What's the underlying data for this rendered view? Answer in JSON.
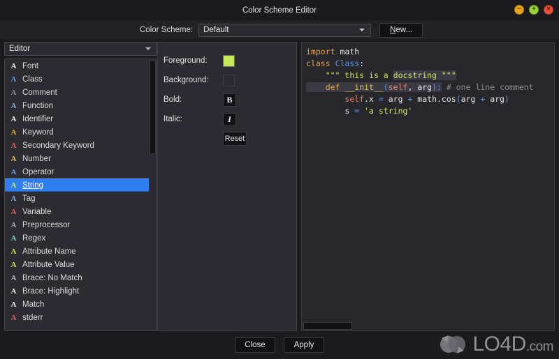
{
  "window": {
    "title": "Color Scheme Editor",
    "controls": [
      {
        "name": "minimize-button",
        "glyph": "−",
        "color": "#e8a51c"
      },
      {
        "name": "maximize-button",
        "glyph": "+",
        "color": "#9bd535"
      },
      {
        "name": "close-button",
        "glyph": "×",
        "color": "#e8533c"
      }
    ]
  },
  "scheme_bar": {
    "label": "Color Scheme:",
    "combo_value": "Default",
    "combo_options": [
      "Default"
    ],
    "new_button": "New..."
  },
  "left_panel": {
    "category_combo_value": "Editor",
    "category_options": [
      "Editor"
    ],
    "items": [
      {
        "label": "Font",
        "glyph": "A",
        "color": "#f2f2f2"
      },
      {
        "label": "Class",
        "glyph": "A",
        "color": "#5a9bf0"
      },
      {
        "label": "Comment",
        "glyph": "A",
        "color": "#8b8b93"
      },
      {
        "label": "Function",
        "glyph": "A",
        "color": "#7fb3e8"
      },
      {
        "label": "Identifier",
        "glyph": "A",
        "color": "#f2f2f2"
      },
      {
        "label": "Keyword",
        "glyph": "A",
        "color": "#e8b33c"
      },
      {
        "label": "Secondary Keyword",
        "glyph": "A",
        "color": "#e8604c"
      },
      {
        "label": "Number",
        "glyph": "A",
        "color": "#e8c84c"
      },
      {
        "label": "Operator",
        "glyph": "A",
        "color": "#6a9fe8"
      },
      {
        "label": "String",
        "glyph": "A",
        "color": "#cfe85c",
        "selected": true
      },
      {
        "label": "Tag",
        "glyph": "A",
        "color": "#7fb3e8"
      },
      {
        "label": "Variable",
        "glyph": "A",
        "color": "#e8604c"
      },
      {
        "label": "Preprocessor",
        "glyph": "A",
        "color": "#b0b0b8"
      },
      {
        "label": "Regex",
        "glyph": "A",
        "color": "#7fd4c8"
      },
      {
        "label": "Attribute Name",
        "glyph": "A",
        "color": "#cfe85c"
      },
      {
        "label": "Attribute Value",
        "glyph": "A",
        "color": "#cfe85c"
      },
      {
        "label": "Brace: No Match",
        "glyph": "A",
        "color": "#b8b8c0"
      },
      {
        "label": "Brace: Highlight",
        "glyph": "A",
        "color": "#f2f2f2"
      },
      {
        "label": "Match",
        "glyph": "A",
        "color": "#f2f2f2"
      },
      {
        "label": "stderr",
        "glyph": "A",
        "color": "#e8604c"
      }
    ]
  },
  "properties": {
    "foreground_label": "Foreground:",
    "foreground_color": "#c8e85c",
    "background_label": "Background:",
    "background_color": "",
    "bold_label": "Bold:",
    "bold_glyph": "B",
    "italic_label": "Italic:",
    "italic_glyph": "I",
    "reset_button": "Reset"
  },
  "preview": {
    "lines": [
      [
        {
          "t": "import",
          "c": "#e8a33c"
        },
        {
          "t": " math",
          "c": "#e6e6ea"
        }
      ],
      [
        {
          "t": "class",
          "c": "#e8a33c"
        },
        {
          "t": " ",
          "c": "#e6e6ea"
        },
        {
          "t": "Class",
          "c": "#5a9bf0"
        },
        {
          "t": ":",
          "c": "#e6e6ea"
        }
      ],
      [
        {
          "t": "    ",
          "c": "#e6e6ea"
        },
        {
          "t": "\"\"\" this is a ",
          "c": "#cfe85c"
        },
        {
          "t": "docstring \"\"\"",
          "c": "#cfe85c",
          "hl": true
        }
      ],
      [
        {
          "t": "    ",
          "c": "#e6e6ea",
          "hl": true
        },
        {
          "t": "def",
          "c": "#e8a33c",
          "hl": true
        },
        {
          "t": " ",
          "c": "#e6e6ea",
          "hl": true
        },
        {
          "t": "__init__",
          "c": "#e8c84c",
          "hl": true
        },
        {
          "t": "(",
          "c": "#5a9bf0",
          "hl": true
        },
        {
          "t": "self",
          "c": "#e8816c",
          "hl": true
        },
        {
          "t": ", ",
          "c": "#e6e6ea",
          "hl": true
        },
        {
          "t": "arg",
          "c": "#e6e6ea",
          "hl": true
        },
        {
          "t": ")",
          "c": "#5a9bf0",
          "hl": true
        },
        {
          "t": ":",
          "c": "#5a9bf0",
          "hl": true
        },
        {
          "t": " ",
          "c": "#e6e6ea"
        },
        {
          "t": "# one line comment",
          "c": "#8b8b93"
        }
      ],
      [
        {
          "t": "        ",
          "c": "#e6e6ea"
        },
        {
          "t": "self",
          "c": "#e8816c"
        },
        {
          "t": ".x ",
          "c": "#e6e6ea"
        },
        {
          "t": "=",
          "c": "#5a9bf0"
        },
        {
          "t": " arg ",
          "c": "#e6e6ea"
        },
        {
          "t": "+",
          "c": "#5a9bf0"
        },
        {
          "t": " math.cos",
          "c": "#e6e6ea"
        },
        {
          "t": "(",
          "c": "#5a9bf0"
        },
        {
          "t": "arg ",
          "c": "#e6e6ea"
        },
        {
          "t": "+",
          "c": "#5a9bf0"
        },
        {
          "t": " arg",
          "c": "#e6e6ea"
        },
        {
          "t": ")",
          "c": "#5a9bf0"
        }
      ],
      [
        {
          "t": "        s ",
          "c": "#e6e6ea"
        },
        {
          "t": "=",
          "c": "#5a9bf0"
        },
        {
          "t": " ",
          "c": "#e6e6ea"
        },
        {
          "t": "'a string'",
          "c": "#cfe85c"
        }
      ]
    ]
  },
  "footer": {
    "close_button": "Close",
    "apply_button": "Apply"
  },
  "watermark": {
    "name": "LO4D",
    "domain": ".com"
  }
}
